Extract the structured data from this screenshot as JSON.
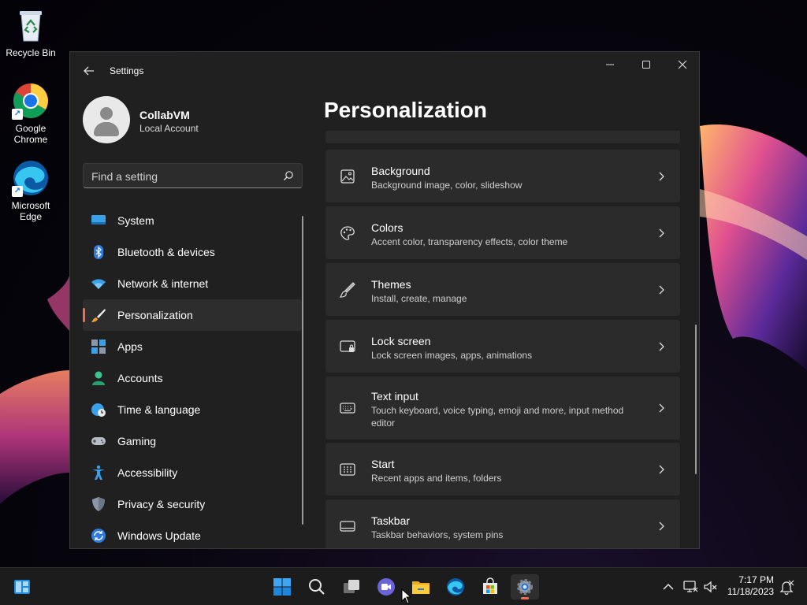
{
  "desktop": {
    "icons": [
      {
        "label": "Recycle Bin"
      },
      {
        "label": "Google Chrome"
      },
      {
        "label": "Microsoft Edge"
      }
    ]
  },
  "window": {
    "title": "Settings",
    "back_icon": "back-arrow-icon",
    "controls": {
      "minimize": "minimize-icon",
      "maximize": "maximize-icon",
      "close": "close-icon"
    }
  },
  "profile": {
    "name": "CollabVM",
    "account_type": "Local Account"
  },
  "search": {
    "placeholder": "Find a setting"
  },
  "nav": {
    "items": [
      {
        "label": "System",
        "icon": "display-icon",
        "active": false
      },
      {
        "label": "Bluetooth & devices",
        "icon": "bluetooth-icon",
        "active": false
      },
      {
        "label": "Network & internet",
        "icon": "wifi-icon",
        "active": false
      },
      {
        "label": "Personalization",
        "icon": "paintbrush-icon",
        "active": true
      },
      {
        "label": "Apps",
        "icon": "apps-icon",
        "active": false
      },
      {
        "label": "Accounts",
        "icon": "person-icon",
        "active": false
      },
      {
        "label": "Time & language",
        "icon": "globe-clock-icon",
        "active": false
      },
      {
        "label": "Gaming",
        "icon": "gamepad-icon",
        "active": false
      },
      {
        "label": "Accessibility",
        "icon": "accessibility-icon",
        "active": false
      },
      {
        "label": "Privacy & security",
        "icon": "shield-icon",
        "active": false
      },
      {
        "label": "Windows Update",
        "icon": "update-icon",
        "active": false
      }
    ]
  },
  "page": {
    "title": "Personalization",
    "cards": [
      {
        "title": "Background",
        "subtitle": "Background image, color, slideshow",
        "icon": "image-icon"
      },
      {
        "title": "Colors",
        "subtitle": "Accent color, transparency effects, color theme",
        "icon": "palette-icon"
      },
      {
        "title": "Themes",
        "subtitle": "Install, create, manage",
        "icon": "brush-icon"
      },
      {
        "title": "Lock screen",
        "subtitle": "Lock screen images, apps, animations",
        "icon": "lock-screen-icon"
      },
      {
        "title": "Text input",
        "subtitle": "Touch keyboard, voice typing, emoji and more, input method editor",
        "icon": "keyboard-icon"
      },
      {
        "title": "Start",
        "subtitle": "Recent apps and items, folders",
        "icon": "start-icon"
      },
      {
        "title": "Taskbar",
        "subtitle": "Taskbar behaviors, system pins",
        "icon": "taskbar-icon"
      }
    ]
  },
  "taskbar": {
    "time": "7:17 PM",
    "date": "11/18/2023"
  },
  "colors": {
    "accent": "#f26d4f",
    "window_bg": "#202020",
    "card_bg": "#2b2b2b"
  }
}
